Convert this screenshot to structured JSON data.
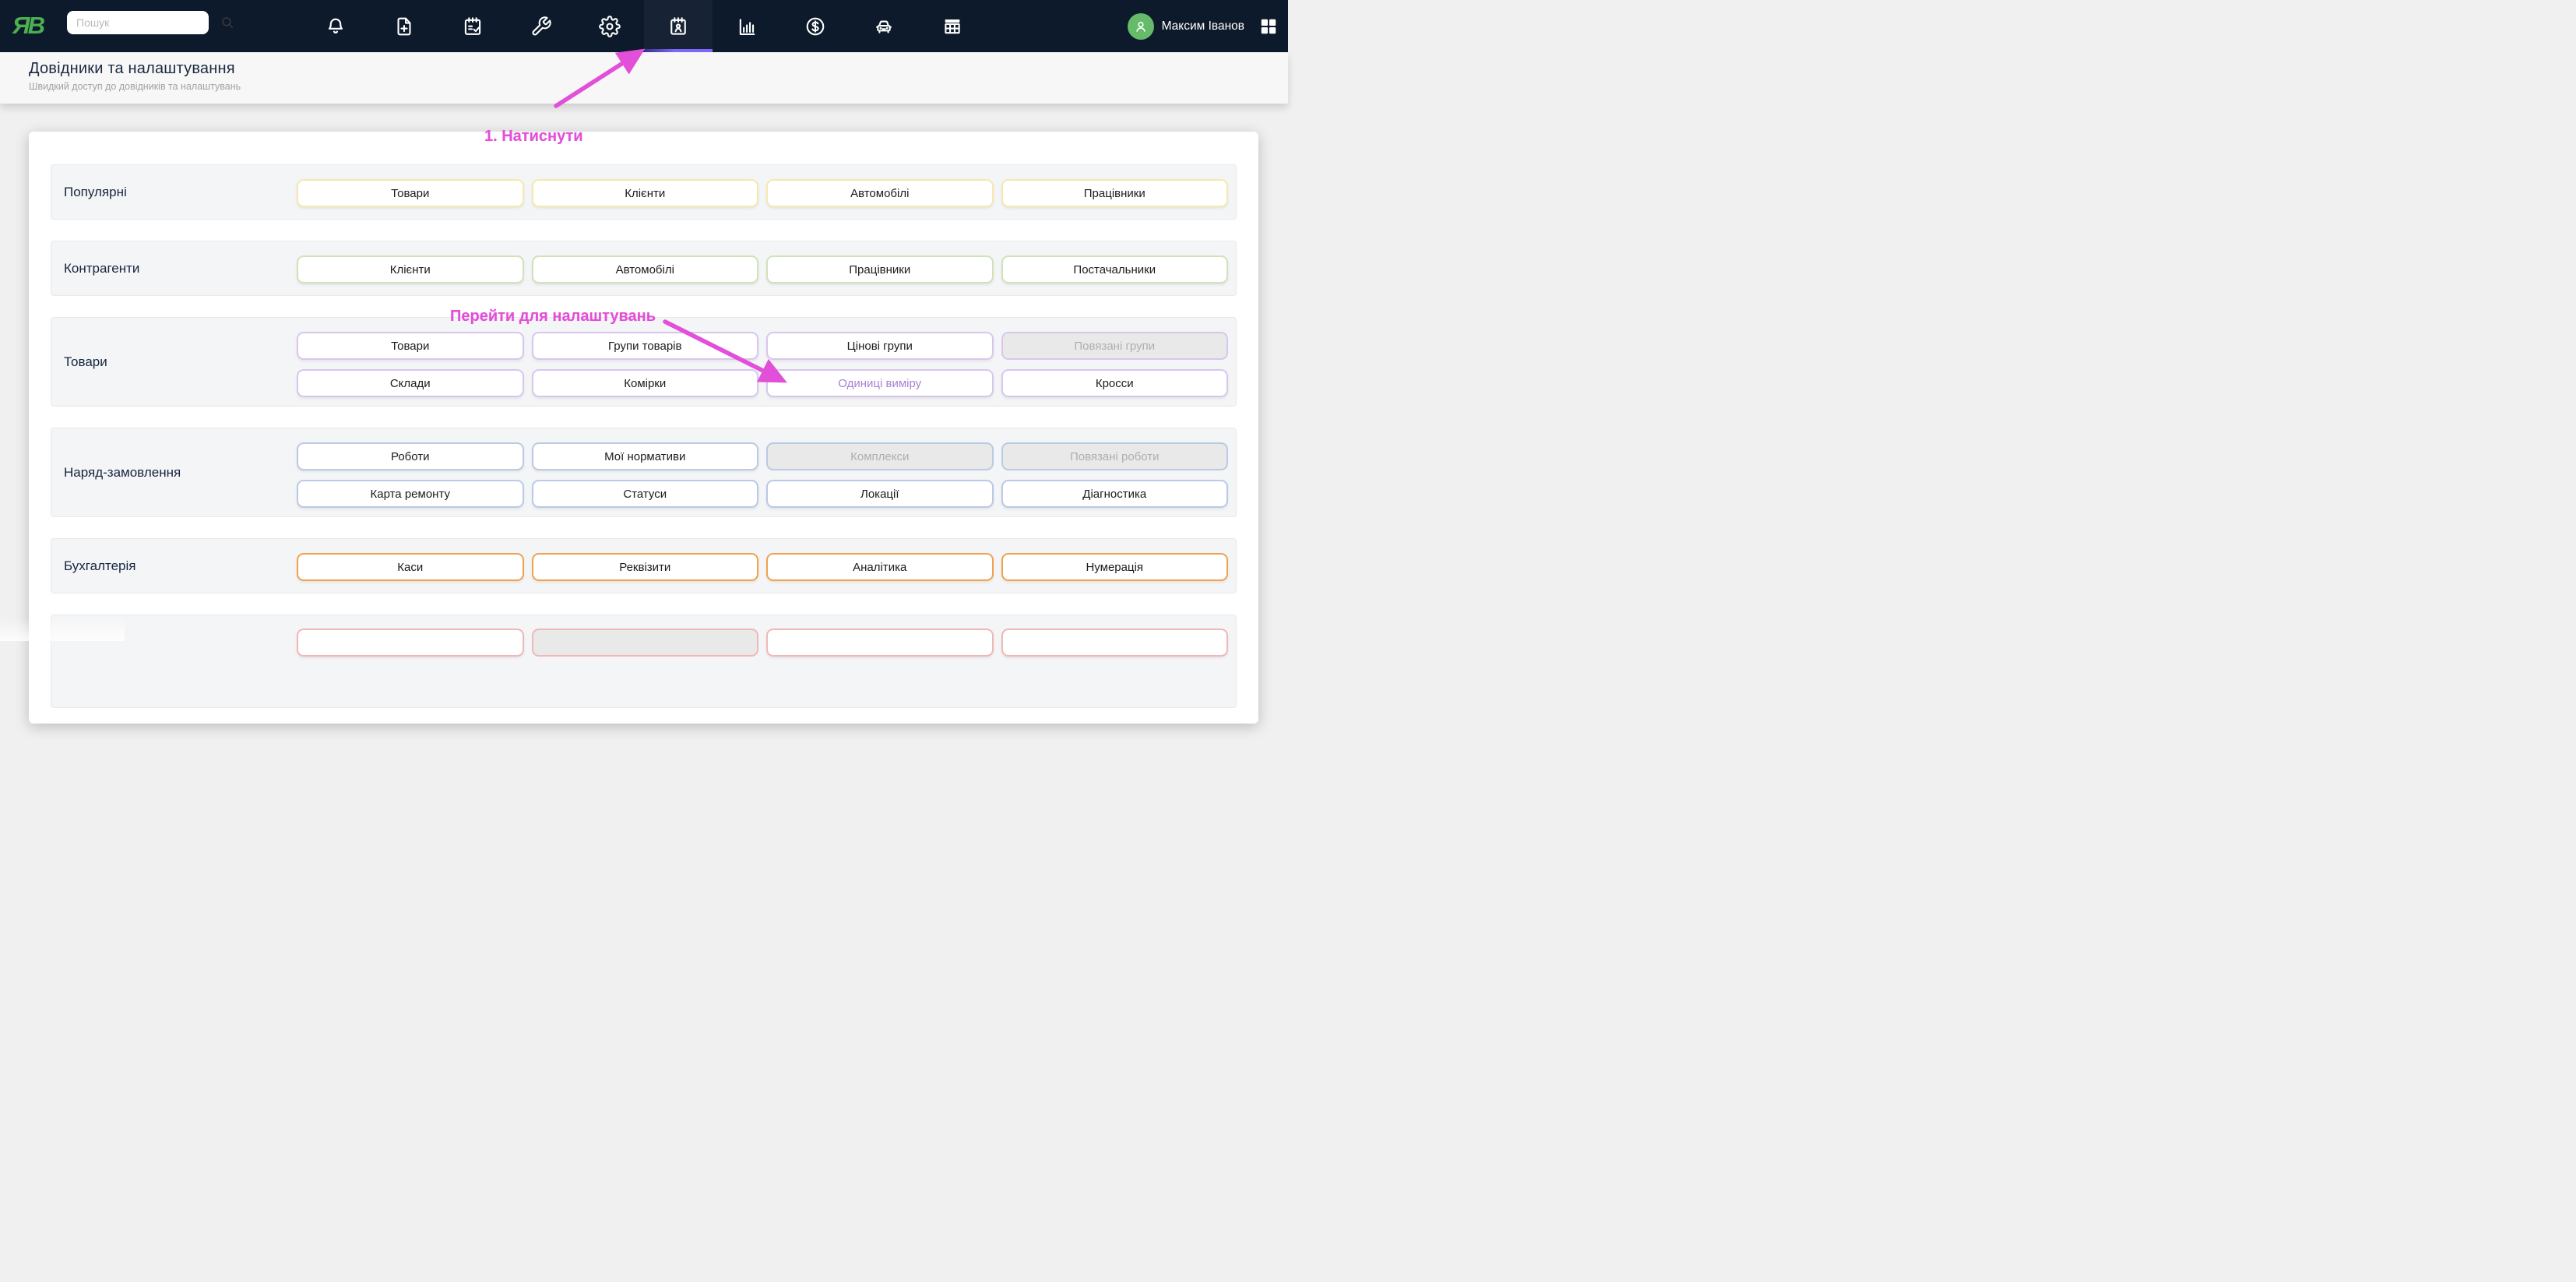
{
  "topbar": {
    "logo_text": "ЯВ",
    "search": {
      "placeholder": "Пошук"
    },
    "nav_items": [
      {
        "icon": "bell-icon",
        "active": false
      },
      {
        "icon": "file-plus-icon",
        "active": false
      },
      {
        "icon": "calendar-check-icon",
        "active": false
      },
      {
        "icon": "wrench-icon",
        "active": false
      },
      {
        "icon": "gear-icon",
        "active": false
      },
      {
        "icon": "calendar-person-icon",
        "active": true
      },
      {
        "icon": "bar-chart-icon",
        "active": false
      },
      {
        "icon": "dollar-circle-icon",
        "active": false
      },
      {
        "icon": "car-icon",
        "active": false
      },
      {
        "icon": "table-icon",
        "active": false
      }
    ],
    "user": {
      "name": "Максим Іванов"
    },
    "colors": {
      "navbar": "#0d1a2b",
      "active_underline": "#7b68fa",
      "logo_green": "#4caf50",
      "avatar_green": "#66bb6a"
    }
  },
  "header": {
    "title": "Довідники та налаштування",
    "subtitle": "Швидкий доступ до довідників та налаштувань"
  },
  "annotations": {
    "step1": "1. Натиснути",
    "step2": "Перейти для налаштувань",
    "color": "#e24fd8"
  },
  "sections": [
    {
      "label": "Популярні",
      "accent": "#f6e9ae",
      "rows": [
        [
          {
            "label": "Товари",
            "state": "normal"
          },
          {
            "label": "Клієнти",
            "state": "normal"
          },
          {
            "label": "Автомобілі",
            "state": "normal"
          },
          {
            "label": "Працівники",
            "state": "normal"
          }
        ]
      ]
    },
    {
      "label": "Контрагенти",
      "accent": "#cfe3ba",
      "rows": [
        [
          {
            "label": "Клієнти",
            "state": "normal"
          },
          {
            "label": "Автомобілі",
            "state": "normal"
          },
          {
            "label": "Працівники",
            "state": "normal"
          },
          {
            "label": "Постачальники",
            "state": "normal"
          }
        ]
      ]
    },
    {
      "label": "Товари",
      "accent": "#d9c6ef",
      "rows": [
        [
          {
            "label": "Товари",
            "state": "normal"
          },
          {
            "label": "Групи товарів",
            "state": "normal"
          },
          {
            "label": "Цінові групи",
            "state": "normal"
          },
          {
            "label": "Повязані групи",
            "state": "disabled"
          }
        ],
        [
          {
            "label": "Склади",
            "state": "normal"
          },
          {
            "label": "Комірки",
            "state": "normal"
          },
          {
            "label": "Одиниці виміру",
            "state": "highlight"
          },
          {
            "label": "Кросси",
            "state": "normal"
          }
        ]
      ]
    },
    {
      "label": "Наряд-замовлення",
      "accent": "#bac9e6",
      "rows": [
        [
          {
            "label": "Роботи",
            "state": "normal"
          },
          {
            "label": "Мої нормативи",
            "state": "normal"
          },
          {
            "label": "Комплекси",
            "state": "disabled"
          },
          {
            "label": "Повязані роботи",
            "state": "disabled"
          }
        ],
        [
          {
            "label": "Карта ремонту",
            "state": "normal"
          },
          {
            "label": "Статуси",
            "state": "normal"
          },
          {
            "label": "Локації",
            "state": "normal"
          },
          {
            "label": "Діагностика",
            "state": "normal"
          }
        ]
      ]
    },
    {
      "label": "Бухгалтерія",
      "accent": "#efa34d",
      "rows": [
        [
          {
            "label": "Каси",
            "state": "normal"
          },
          {
            "label": "Реквізити",
            "state": "normal"
          },
          {
            "label": "Аналітика",
            "state": "normal"
          },
          {
            "label": "Нумерація",
            "state": "normal"
          }
        ]
      ]
    },
    {
      "label": "",
      "accent": "#f1b7b7",
      "partial": true,
      "rows": [
        [
          {
            "label": "",
            "state": "normal"
          },
          {
            "label": "",
            "state": "disabled"
          },
          {
            "label": "",
            "state": "normal"
          },
          {
            "label": "",
            "state": "normal"
          }
        ]
      ]
    }
  ]
}
